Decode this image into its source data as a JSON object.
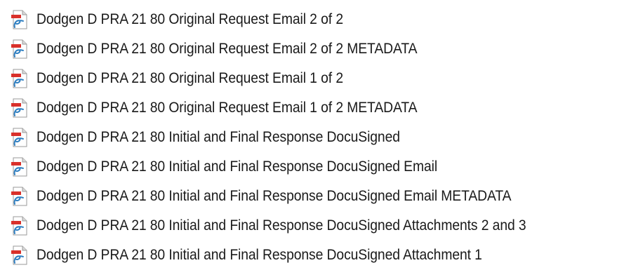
{
  "files": [
    {
      "name": "Dodgen D PRA 21 80 Original Request Email 2 of 2",
      "icon": "pdf-file-icon"
    },
    {
      "name": "Dodgen D PRA 21 80 Original Request Email 2 of 2 METADATA",
      "icon": "pdf-file-icon"
    },
    {
      "name": "Dodgen D PRA 21 80 Original Request Email 1 of 2",
      "icon": "pdf-file-icon"
    },
    {
      "name": "Dodgen D PRA 21 80 Original Request Email 1 of 2 METADATA",
      "icon": "pdf-file-icon"
    },
    {
      "name": "Dodgen D PRA 21 80 Initial and Final Response DocuSigned",
      "icon": "pdf-file-icon"
    },
    {
      "name": "Dodgen D PRA 21 80 Initial and Final Response DocuSigned Email",
      "icon": "pdf-file-icon"
    },
    {
      "name": "Dodgen D PRA 21 80 Initial and Final Response DocuSigned Email METADATA",
      "icon": "pdf-file-icon"
    },
    {
      "name": "Dodgen D PRA 21 80 Initial and Final Response DocuSigned Attachments 2 and 3",
      "icon": "pdf-file-icon"
    },
    {
      "name": "Dodgen D PRA 21 80 Initial and Final Response DocuSigned Attachment 1",
      "icon": "pdf-file-icon"
    }
  ],
  "colors": {
    "icon_page": "#ffffff",
    "icon_border": "#9a9a9a",
    "icon_fold": "#d9d9d9",
    "icon_red": "#d9302a",
    "icon_blue": "#2f7fc1",
    "text": "#1a1a1a"
  }
}
